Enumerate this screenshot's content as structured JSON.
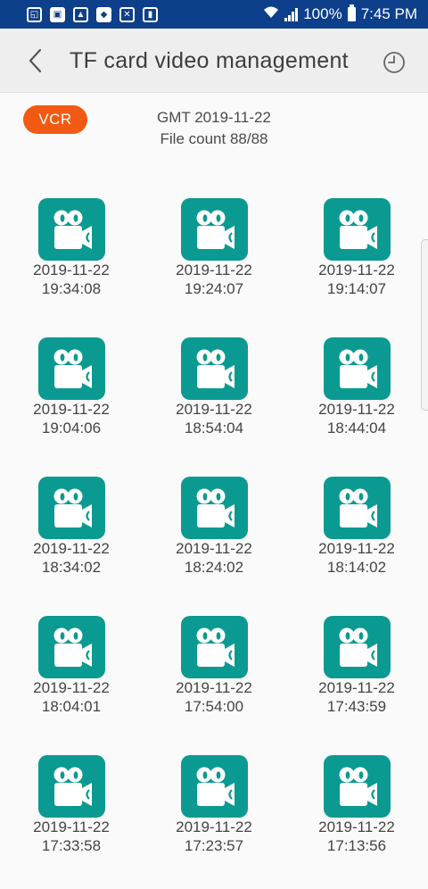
{
  "status_bar": {
    "battery": "100%",
    "time": "7:45 PM",
    "icons": [
      "gallery-icon",
      "vcr-app-icon",
      "image-icon",
      "shield-icon",
      "close-box-icon",
      "sd-card-icon"
    ]
  },
  "app_bar": {
    "title": "TF card video management",
    "back_icon": "chevron-left-icon",
    "history_icon": "history-clock-icon"
  },
  "vcr_button": {
    "label": "VCR",
    "color": "#f25a13"
  },
  "summary": {
    "date_line": "GMT 2019-11-22",
    "count_line": "File count 88/88"
  },
  "accent_color": "#0b9a91",
  "files": [
    {
      "date": "2019-11-22",
      "time": "19:34:08"
    },
    {
      "date": "2019-11-22",
      "time": "19:24:07"
    },
    {
      "date": "2019-11-22",
      "time": "19:14:07"
    },
    {
      "date": "2019-11-22",
      "time": "19:04:06"
    },
    {
      "date": "2019-11-22",
      "time": "18:54:04"
    },
    {
      "date": "2019-11-22",
      "time": "18:44:04"
    },
    {
      "date": "2019-11-22",
      "time": "18:34:02"
    },
    {
      "date": "2019-11-22",
      "time": "18:24:02"
    },
    {
      "date": "2019-11-22",
      "time": "18:14:02"
    },
    {
      "date": "2019-11-22",
      "time": "18:04:01"
    },
    {
      "date": "2019-11-22",
      "time": "17:54:00"
    },
    {
      "date": "2019-11-22",
      "time": "17:43:59"
    },
    {
      "date": "2019-11-22",
      "time": "17:33:58"
    },
    {
      "date": "2019-11-22",
      "time": "17:23:57"
    },
    {
      "date": "2019-11-22",
      "time": "17:13:56"
    }
  ]
}
